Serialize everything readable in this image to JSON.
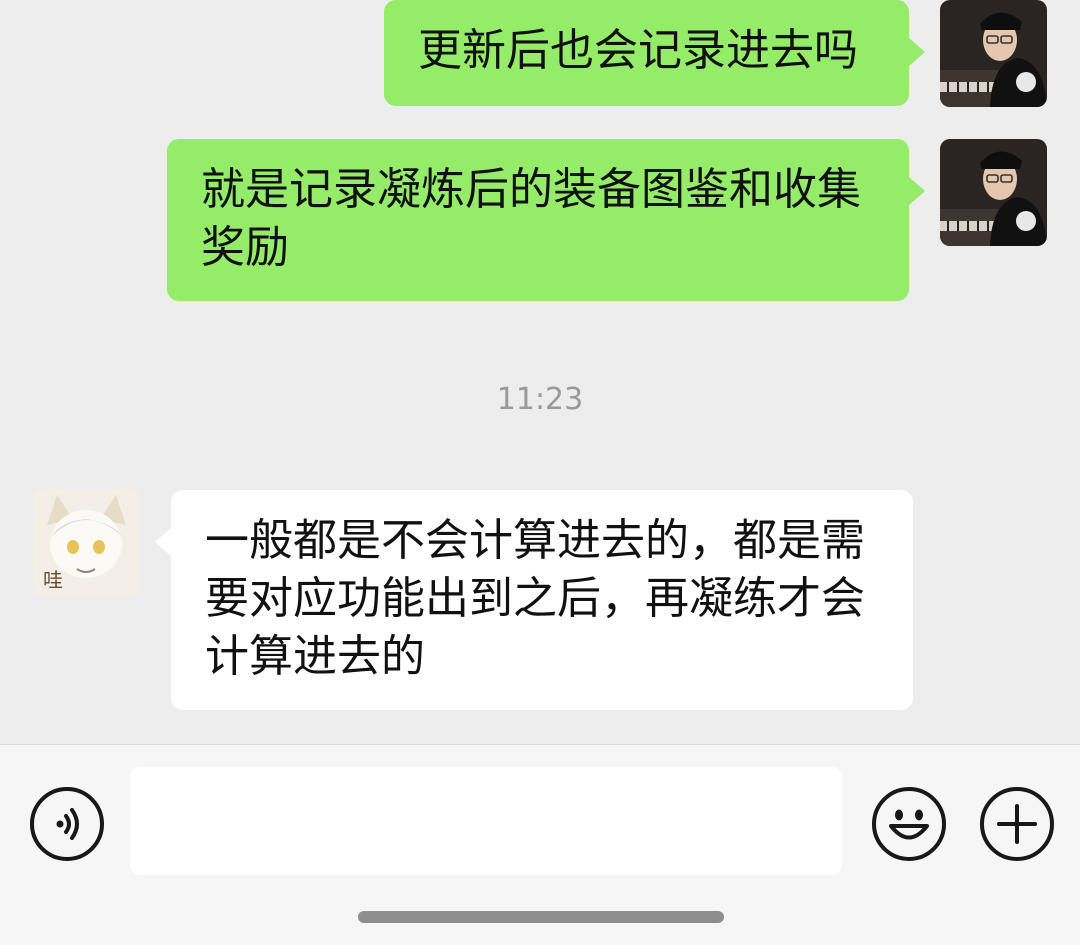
{
  "messages": [
    {
      "side": "out",
      "text": "更新后也会记录进去吗",
      "avatar": "user-photo"
    },
    {
      "side": "out",
      "text": "就是记录凝炼后的装备图鉴和收集奖励",
      "avatar": "user-photo"
    },
    {
      "side": "in",
      "text": "一般都是不会计算进去的，都是需要对应功能出到之后，再凝练才会计算进去的",
      "avatar": "anime-avatar"
    }
  ],
  "timestamp": "11:23",
  "avatar_sticker_text": "哇",
  "input": {
    "value": "",
    "placeholder": ""
  },
  "icons": {
    "voice": "voice-icon",
    "emoji": "emoji-icon",
    "plus": "plus-icon"
  },
  "colors": {
    "outgoing_bubble": "#95ec69",
    "incoming_bubble": "#ffffff",
    "background": "#ededed"
  }
}
